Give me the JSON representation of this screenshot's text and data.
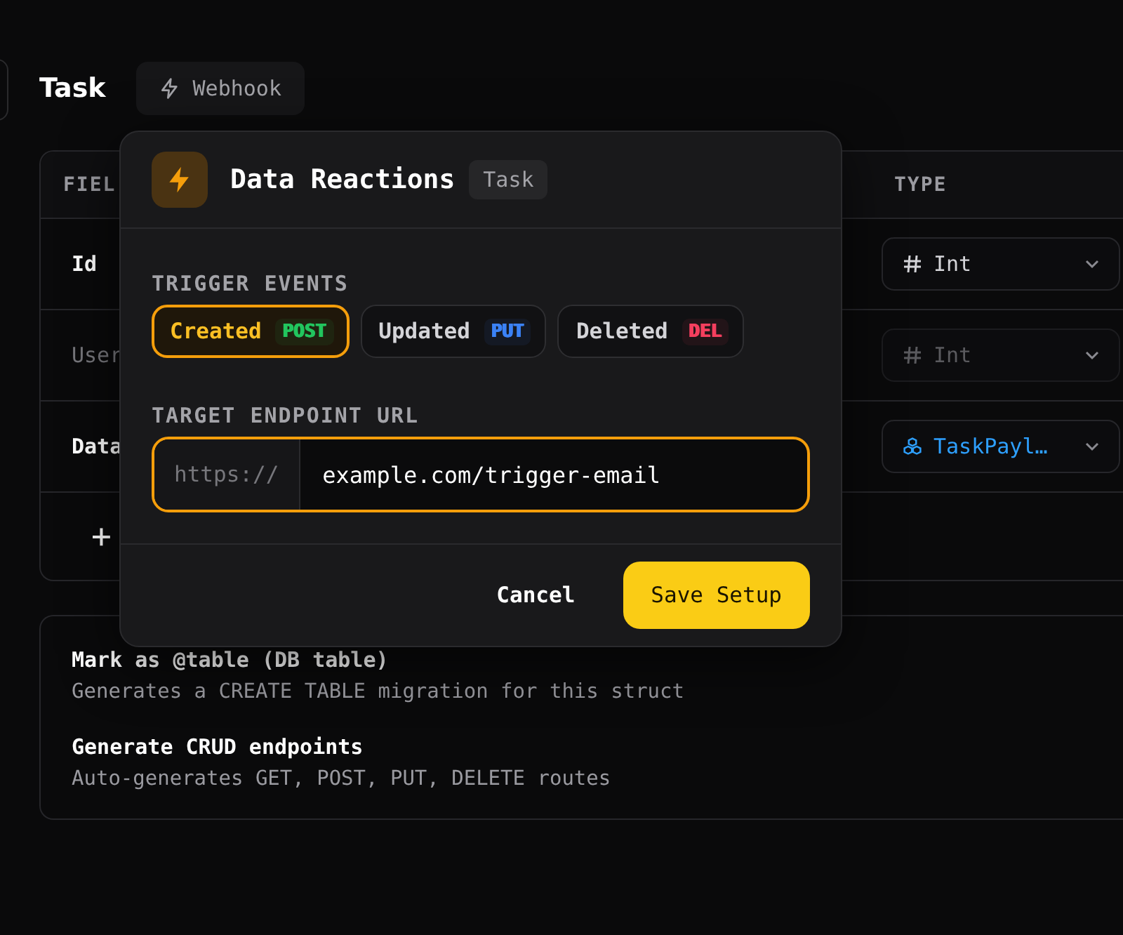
{
  "header": {
    "title": "Task",
    "webhook_button": {
      "label": "Webhook"
    }
  },
  "table": {
    "columns": [
      "FIEL",
      "TYPE"
    ],
    "rows": [
      {
        "field": "Id",
        "type": "Int",
        "kind": "scalar",
        "disabled": false
      },
      {
        "field": "User",
        "type": "Int",
        "kind": "scalar",
        "disabled": true
      },
      {
        "field": "Data",
        "type": "TaskPayl…",
        "kind": "struct",
        "disabled": false
      }
    ],
    "add_row": "+"
  },
  "options": [
    {
      "title": "Mark as @table (DB table)",
      "description": "Generates a CREATE TABLE migration for this struct"
    },
    {
      "title": "Generate CRUD endpoints",
      "description": "Auto-generates GET, POST, PUT, DELETE routes"
    }
  ],
  "modal": {
    "title": "Data Reactions",
    "badge": "Task",
    "events_label": "TRIGGER EVENTS",
    "events": [
      {
        "label": "Created",
        "method": "POST",
        "color": "#22c55e",
        "selected": true
      },
      {
        "label": "Updated",
        "method": "PUT",
        "color": "#3b82f6",
        "selected": false
      },
      {
        "label": "Deleted",
        "method": "DEL",
        "color": "#f43f5e",
        "selected": false
      }
    ],
    "url_label": "TARGET ENDPOINT URL",
    "url": {
      "prefix": "https://",
      "value": "example.com/trigger-email"
    },
    "cancel": "Cancel",
    "save": "Save Setup"
  }
}
